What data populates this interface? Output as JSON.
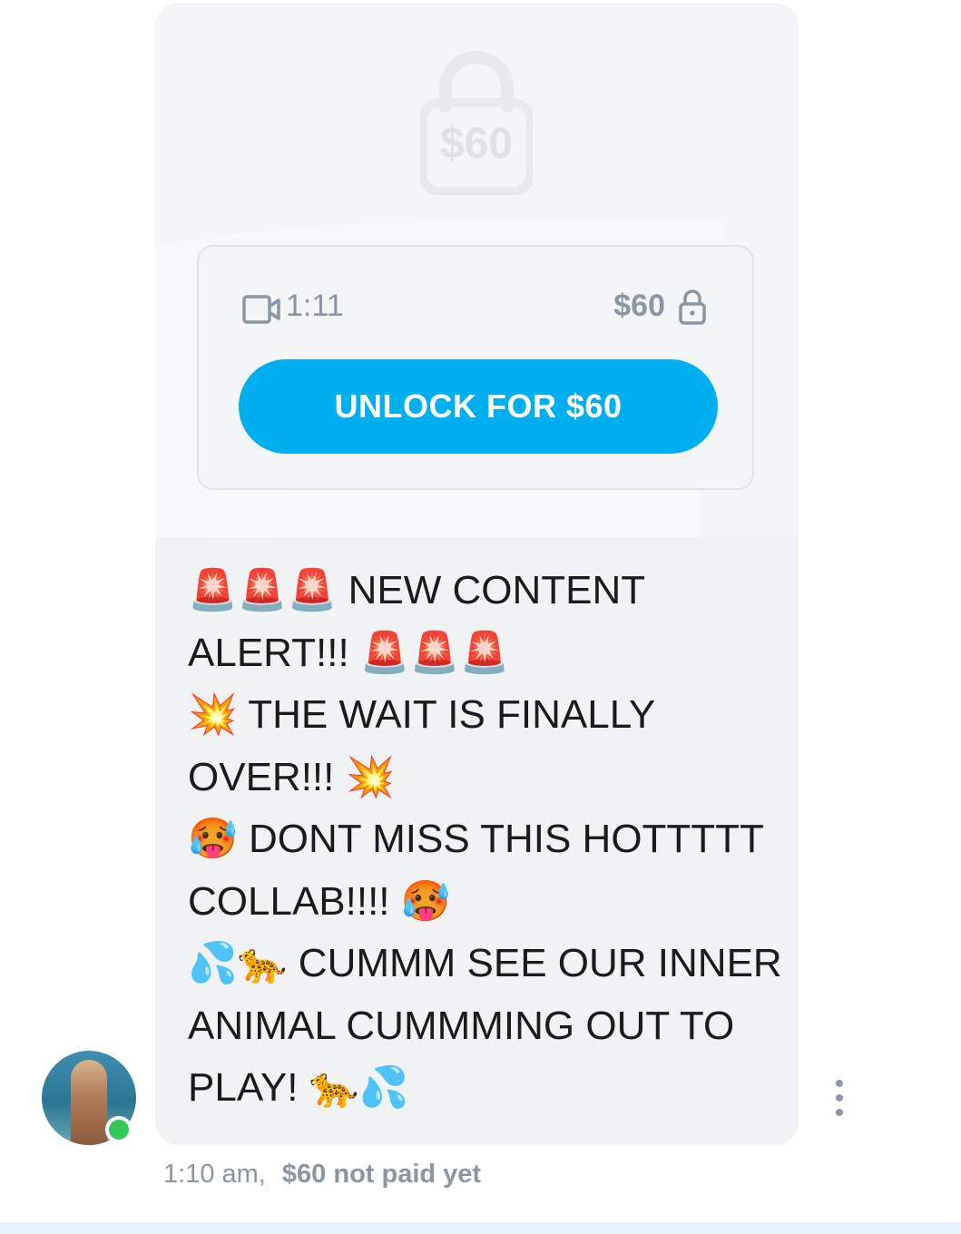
{
  "message": {
    "locked_media": {
      "overlay_price": "$60",
      "duration": "1:11",
      "price": "$60",
      "unlock_button_label": "UNLOCK FOR $60"
    },
    "text_lines": [
      "🚨🚨🚨 NEW CONTENT",
      "ALERT!!! 🚨🚨🚨",
      "💥 THE WAIT IS FINALLY",
      "OVER!!! 💥",
      "🥵 DONT MISS THIS HOTTTTT",
      "COLLAB!!!! 🥵",
      "💦🐆 CUMMM SEE OUR INNER",
      "ANIMAL CUMMMING OUT TO",
      "PLAY! 🐆💦"
    ],
    "timestamp": "1:10 am,",
    "payment_status": "$60 not paid yet"
  },
  "sender": {
    "online": true
  },
  "colors": {
    "accent": "#00aff0",
    "online": "#34c759",
    "muted_text": "#8a96a3",
    "bubble": "#f1f2f4"
  },
  "icons": [
    "lock-icon",
    "video-icon",
    "more-options-icon"
  ]
}
